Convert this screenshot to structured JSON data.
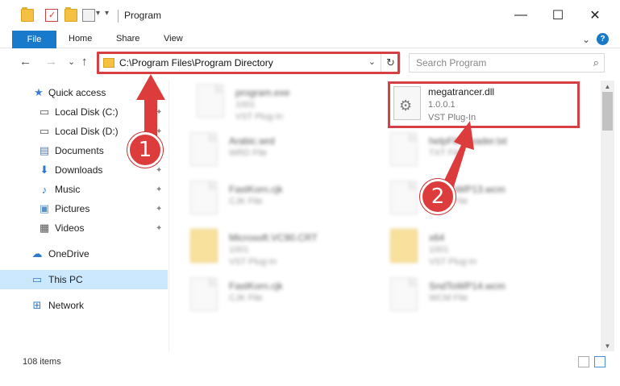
{
  "window": {
    "title": "Program",
    "minimize": "—",
    "maximize": "☐",
    "close": "✕",
    "qa_dropdown": "▾"
  },
  "ribbon": {
    "file": "File",
    "tabs": [
      "Home",
      "Share",
      "View"
    ],
    "expand": "⌄",
    "help": "?"
  },
  "navigation": {
    "back": "←",
    "forward": "→",
    "recent": "⌄",
    "up": "↑",
    "address": "C:\\Program Files\\Program Directory",
    "address_dropdown": "⌄",
    "refresh": "↻",
    "search_placeholder": "Search Program",
    "search_icon": "⌕"
  },
  "sidebar": {
    "items": [
      {
        "label": "Quick access",
        "icon": "star-icon",
        "glyph": "★",
        "color": "#3a7bd5",
        "pinned": false
      },
      {
        "label": "Local Disk (C:)",
        "icon": "drive-icon",
        "glyph": "▭",
        "color": "#555555",
        "pinned": true
      },
      {
        "label": "Local Disk (D:)",
        "icon": "drive-icon",
        "glyph": "▭",
        "color": "#555555",
        "pinned": true
      },
      {
        "label": "Documents",
        "icon": "documents-icon",
        "glyph": "▤",
        "color": "#5b7fa8",
        "pinned": true
      },
      {
        "label": "Downloads",
        "icon": "download-icon",
        "glyph": "⬇",
        "color": "#2b79d0",
        "pinned": true
      },
      {
        "label": "Music",
        "icon": "music-icon",
        "glyph": "♪",
        "color": "#2b79d0",
        "pinned": true
      },
      {
        "label": "Pictures",
        "icon": "pictures-icon",
        "glyph": "▣",
        "color": "#5b8fc7",
        "pinned": true
      },
      {
        "label": "Videos",
        "icon": "videos-icon",
        "glyph": "▦",
        "color": "#555555",
        "pinned": true
      },
      {
        "label": "OneDrive",
        "icon": "cloud-icon",
        "glyph": "☁",
        "color": "#2b79d0",
        "pinned": false
      },
      {
        "label": "This PC",
        "icon": "computer-icon",
        "glyph": "▭",
        "color": "#2b79d0",
        "pinned": false,
        "selected": true
      },
      {
        "label": "Network",
        "icon": "network-icon",
        "glyph": "⊞",
        "color": "#2b79d0",
        "pinned": false
      }
    ],
    "pin_glyph": "📌"
  },
  "files": [
    {
      "name": "program.exe",
      "line1": "1001",
      "line2": "VST Plug-In",
      "kind": "exe"
    },
    {
      "name": "megatrancer.dll",
      "line1": "1.0.0.1",
      "line2": "VST Plug-In",
      "kind": "dll",
      "highlighted": true
    },
    {
      "name": "Arabic.wrd",
      "line1": "WRD File",
      "line2": "",
      "kind": "doc"
    },
    {
      "name": "helpFileReader.txt",
      "line1": "TXT File",
      "line2": "",
      "kind": "doc"
    },
    {
      "name": "FastKorn.cjk",
      "line1": "CJK File",
      "line2": "",
      "kind": "doc"
    },
    {
      "name": "SndToWP13.wcm",
      "line1": "WCM File",
      "line2": "",
      "kind": "doc"
    },
    {
      "name": "Microsoft.VC90.CRT",
      "line1": "1001",
      "line2": "VST Plug-In",
      "kind": "folder"
    },
    {
      "name": "x64",
      "line1": "1001",
      "line2": "VST Plug-In",
      "kind": "folder"
    },
    {
      "name": "FastKorn.cjk",
      "line1": "CJK File",
      "line2": "",
      "kind": "doc"
    },
    {
      "name": "SndToWP14.wcm",
      "line1": "WCM File",
      "line2": "",
      "kind": "doc"
    }
  ],
  "gear_glyph": "⚙",
  "scroll": {
    "up": "▲",
    "down": "▼"
  },
  "status": {
    "items_count": "108 items"
  },
  "callouts": {
    "one": "1",
    "two": "2"
  },
  "colors": {
    "accent": "#1979ca",
    "highlight": "#d64045",
    "selected": "#cce8ff"
  }
}
